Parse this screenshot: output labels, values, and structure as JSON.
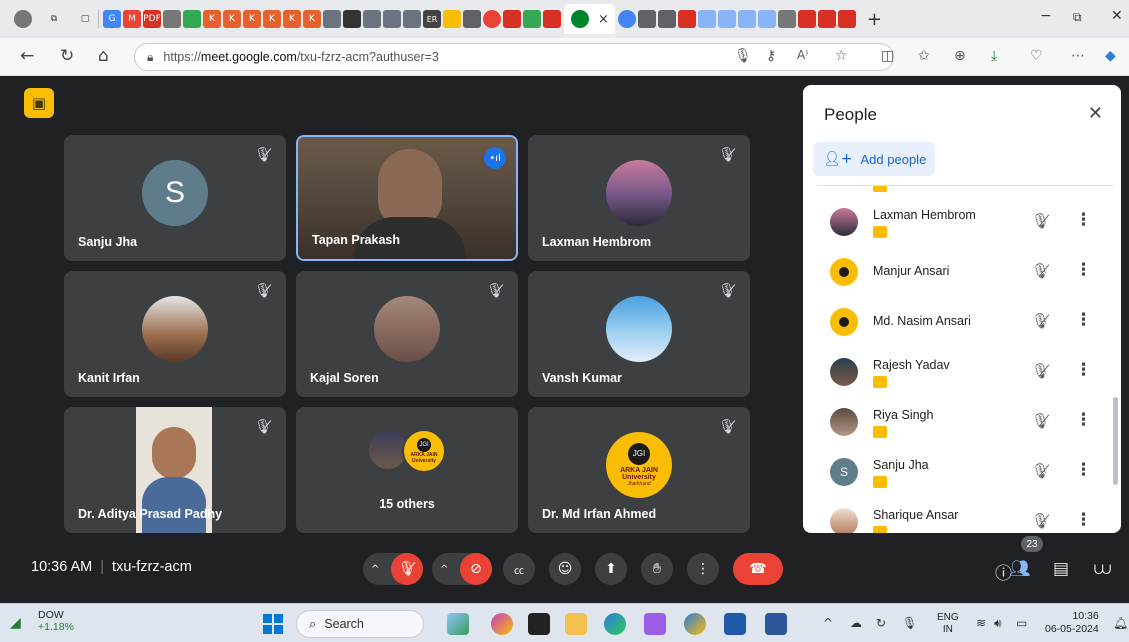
{
  "browser": {
    "url_prefix": "https://",
    "url_host": "meet.google.com",
    "url_path": "/txu-fzrz-acm?authuser=3",
    "new_tab_symbol": "+",
    "tab_close_symbol": "×",
    "tab_er_label": "ER",
    "tab_pdf_label": "PDF"
  },
  "meet": {
    "tiles": [
      {
        "name": "Sanju Jha",
        "initial": "S",
        "type": "initial",
        "muted": true
      },
      {
        "name": "Tapan Prakash",
        "type": "video",
        "speaking": true
      },
      {
        "name": "Laxman Hembrom",
        "type": "photo",
        "muted": true
      },
      {
        "name": "Kanit Irfan",
        "type": "photo",
        "muted": true
      },
      {
        "name": "Kajal Soren",
        "type": "photo",
        "muted": true
      },
      {
        "name": "Vansh Kumar",
        "type": "photo",
        "muted": true
      },
      {
        "name": "Dr. Aditya Prasad Padhy",
        "type": "video",
        "muted": true
      },
      {
        "name": "15 others",
        "type": "group"
      },
      {
        "name": "Dr. Md Irfan Ahmed",
        "type": "logo",
        "muted": true
      }
    ],
    "logo": {
      "badge": "JGI",
      "line1": "ARKA JAIN",
      "line2": "University",
      "line3": "Jharkhand"
    },
    "time": "10:36 AM",
    "meeting_code": "txu-fzrz-acm",
    "participant_count": "23"
  },
  "people_panel": {
    "title": "People",
    "add_label": "Add people",
    "participants": [
      {
        "name": "Laxman Hembrom",
        "tagged": true,
        "avatar": "photo"
      },
      {
        "name": "Manjur Ansari",
        "tagged": false,
        "avatar": "logo"
      },
      {
        "name": "Md. Nasim Ansari",
        "tagged": false,
        "avatar": "logo"
      },
      {
        "name": "Rajesh Yadav",
        "tagged": true,
        "avatar": "photo"
      },
      {
        "name": "Riya Singh",
        "tagged": true,
        "avatar": "photo"
      },
      {
        "name": "Sanju Jha",
        "tagged": true,
        "avatar": "initial",
        "initial": "S"
      },
      {
        "name": "Sharique Ansar",
        "tagged": true,
        "avatar": "photo"
      }
    ]
  },
  "taskbar": {
    "ticker_name": "DOW",
    "ticker_change": "+1.18%",
    "search_label": "Search",
    "lang_line1": "ENG",
    "lang_line2": "IN",
    "clock_time": "10:36",
    "clock_date": "06-05-2024"
  },
  "colors": {
    "meet_bg": "#202124",
    "tile_bg": "#3c4043",
    "accent_red": "#ea4335",
    "accent_blue": "#1a73e8",
    "badge_yellow": "#fbbc04"
  }
}
